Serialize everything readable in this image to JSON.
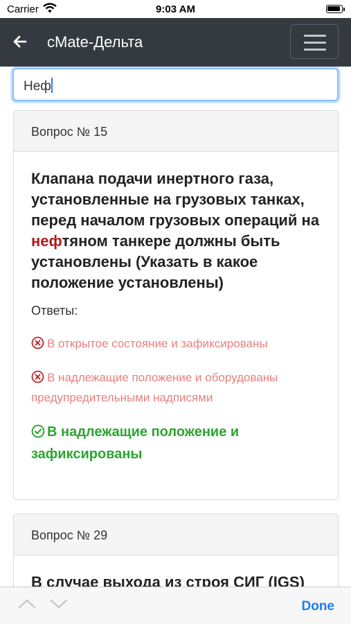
{
  "status_bar": {
    "carrier": "Carrier",
    "time": "9:03 AM"
  },
  "header": {
    "title": "cMate-Дельта",
    "back_icon": "arrow-left-icon",
    "menu_icon": "hamburger-menu-icon"
  },
  "search": {
    "value": "Неф"
  },
  "questions": [
    {
      "header": "Вопрос № 15",
      "text_before": "Клапана подачи инертного газа, установленные на грузовых танках, перед началом грузовых операций на ",
      "highlight": "неф",
      "text_after": "тяном танкере должны быть установлены (Указать в какое положение установлены)",
      "answers_label": "Ответы:",
      "answers": [
        {
          "text": "В открытое состояние и зафиксированы",
          "status": "wrong",
          "icon": "x-circle-icon"
        },
        {
          "text": "В надлежащие положение и оборудованы предупредительными надписями",
          "status": "wrong",
          "icon": "x-circle-icon"
        },
        {
          "text": "В надлежащие положение и зафиксированы",
          "status": "correct",
          "icon": "check-circle-icon"
        }
      ]
    },
    {
      "header": "Вопрос № 29",
      "text": "В случае выхода из строя СИГ (IGS)"
    }
  ],
  "keyboard_toolbar": {
    "done_label": "Done",
    "prev_icon": "chevron-up-icon",
    "next_icon": "chevron-down-icon"
  },
  "colors": {
    "navbar": "#343a40",
    "wrong": "#e6807f",
    "correct": "#2aa52f",
    "highlight": "#b0191e",
    "done": "#1a7ef7"
  }
}
